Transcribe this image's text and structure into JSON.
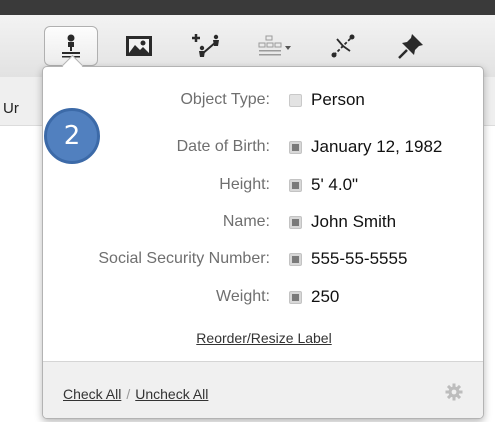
{
  "toolbar": {
    "buttons": [
      {
        "icon": "person-icon",
        "active": true
      },
      {
        "icon": "image-icon",
        "active": false
      },
      {
        "icon": "add-link-icon",
        "active": false
      },
      {
        "icon": "layout-icon",
        "active": false
      },
      {
        "icon": "link-network-icon",
        "active": false
      },
      {
        "icon": "pin-icon",
        "active": false
      }
    ]
  },
  "background": {
    "partial_text": "Ur"
  },
  "step_badge": "2",
  "popover": {
    "fields": [
      {
        "label": "Object Type:",
        "value": "Person",
        "checked": false
      },
      {
        "label": "Date of Birth:",
        "value": "January 12, 1982",
        "checked": true
      },
      {
        "label": "Height:",
        "value": "5' 4.0\"",
        "checked": true
      },
      {
        "label": "Name:",
        "value": "John Smith",
        "checked": true
      },
      {
        "label": "Social Security Number:",
        "value": "555-55-5555",
        "checked": true
      },
      {
        "label": "Weight:",
        "value": "250",
        "checked": true
      }
    ],
    "reorder_link": "Reorder/Resize Label",
    "footer": {
      "check_all": "Check All",
      "separator": "/",
      "uncheck_all": "Uncheck All"
    }
  },
  "colors": {
    "badge": "#5180bf",
    "top_bar": "#3a3a3a"
  }
}
